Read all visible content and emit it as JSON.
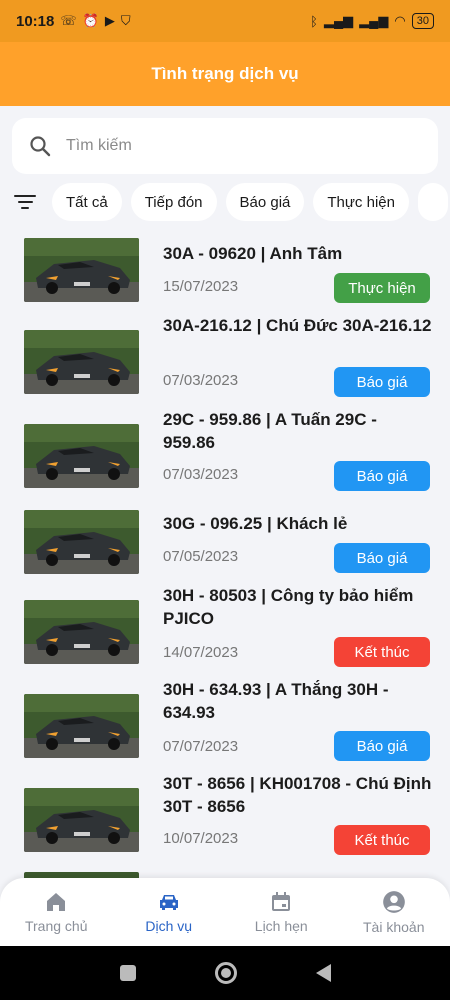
{
  "status_bar": {
    "time": "10:18",
    "battery": "30"
  },
  "header": {
    "title": "Tình trạng dịch vụ"
  },
  "search": {
    "placeholder": "Tìm kiếm",
    "value": ""
  },
  "filters": [
    "Tất cả",
    "Tiếp đón",
    "Báo giá",
    "Thực hiện"
  ],
  "colors": {
    "accent": "#ffa12a",
    "status_bar": "#f09a20",
    "green": "#43a047",
    "blue": "#2196f3",
    "red": "#f44336",
    "nav_active": "#2a64c6"
  },
  "services": [
    {
      "title": "30A - 09620 | Anh Tâm",
      "date": "15/07/2023",
      "status": "Thực hiện",
      "status_color": "green"
    },
    {
      "title": "30A-216.12 | Chú Đức 30A-216.12",
      "date": "07/03/2023",
      "status": "Báo giá",
      "status_color": "blue"
    },
    {
      "title": "29C - 959.86 | A Tuấn 29C - 959.86",
      "date": "07/03/2023",
      "status": "Báo giá",
      "status_color": "blue"
    },
    {
      "title": "30G - 096.25 | Khách lẻ",
      "date": "07/05/2023",
      "status": "Báo giá",
      "status_color": "blue"
    },
    {
      "title": "30H - 80503 | Công ty bảo hiểm PJICO",
      "date": "14/07/2023",
      "status": "Kết thúc",
      "status_color": "red"
    },
    {
      "title": "30H - 634.93 | A Thắng 30H - 634.93",
      "date": "07/07/2023",
      "status": "Báo giá",
      "status_color": "blue"
    },
    {
      "title": "30T - 8656 | KH001708 - Chú Định 30T - 8656",
      "date": "10/07/2023",
      "status": "Kết thúc",
      "status_color": "red"
    }
  ],
  "bottom_nav": [
    {
      "label": "Trang chủ",
      "icon": "home-icon"
    },
    {
      "label": "Dịch vụ",
      "icon": "car-icon",
      "active": true
    },
    {
      "label": "Lịch hẹn",
      "icon": "calendar-icon"
    },
    {
      "label": "Tài khoản",
      "icon": "account-icon"
    }
  ]
}
